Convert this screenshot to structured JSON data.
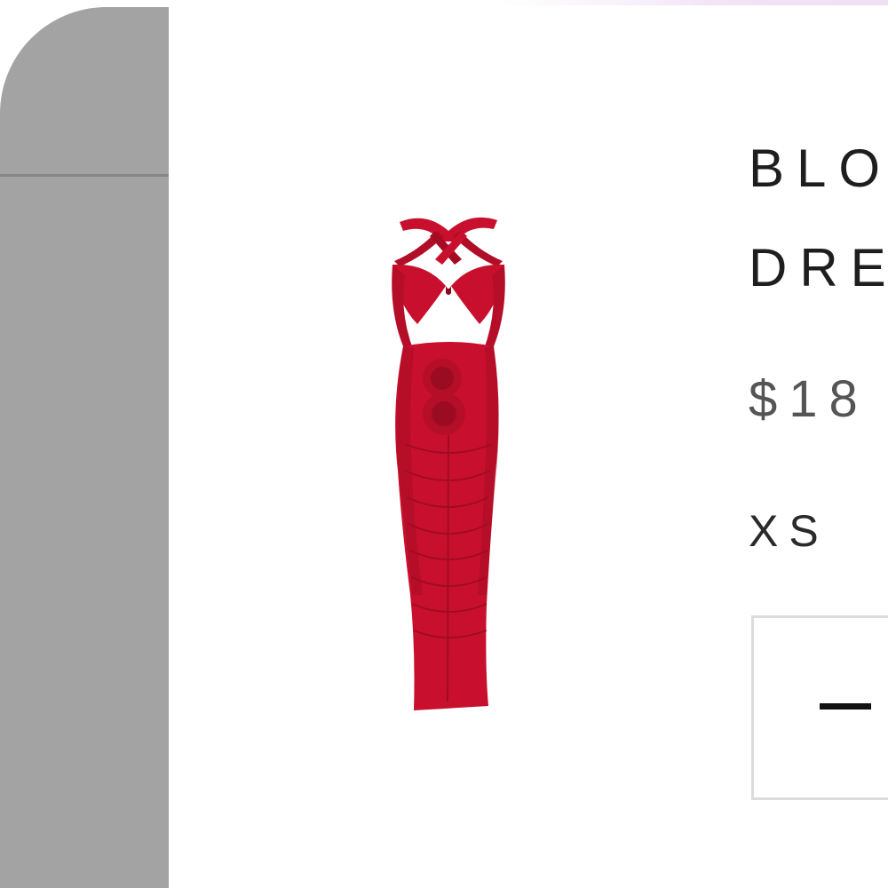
{
  "product": {
    "title_line_1": "BLO",
    "title_line_2": "DRE",
    "price": "$18",
    "size": "XS",
    "image_color": "#c8102e"
  },
  "quantity": {
    "decrement_symbol": "–",
    "decrement_icon": "minus-icon"
  },
  "colors": {
    "side_panel": "#a3a3a3",
    "divider": "#878787",
    "title_text": "#1e1e1e",
    "price_text": "#555555",
    "box_border": "#dcdcdc"
  }
}
